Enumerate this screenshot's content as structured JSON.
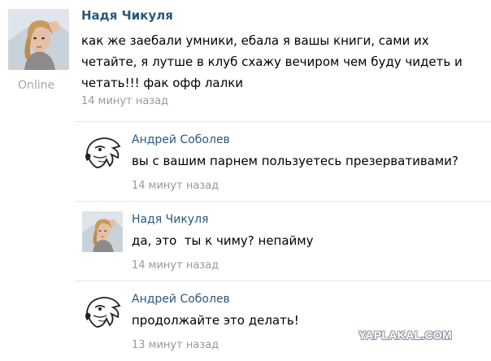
{
  "post": {
    "author": "Надя Чикуля",
    "status": "Online",
    "text": "как же заебали умники, ебала я вашы книги, сами их четайте, я лутше в клуб схажу вечиром чем буду чидеть и четать!!! фак офф лалки",
    "time": "14 минут назад",
    "avatar_icon": "girl-photo-avatar"
  },
  "comments": [
    {
      "author": "Андрей Соболев",
      "text": "вы с вашим парнем пользуетесь презервативами?",
      "time": "14 минут назад",
      "avatar_icon": "eagle-sketch-avatar"
    },
    {
      "author": "Надя Чикуля",
      "text": "да, это  ты к чиму? непайму",
      "time": "14 минут назад",
      "avatar_icon": "girl-photo-avatar"
    },
    {
      "author": "Андрей Соболев",
      "text": "продолжайте это делать!",
      "time": "13 минут назад",
      "avatar_icon": "eagle-sketch-avatar"
    }
  ],
  "watermark": "YAPLAKAL.COM",
  "colors": {
    "author_link": "#2b587a",
    "time": "#999999",
    "status": "#a6a6a6",
    "divider": "#e4e8ed"
  }
}
